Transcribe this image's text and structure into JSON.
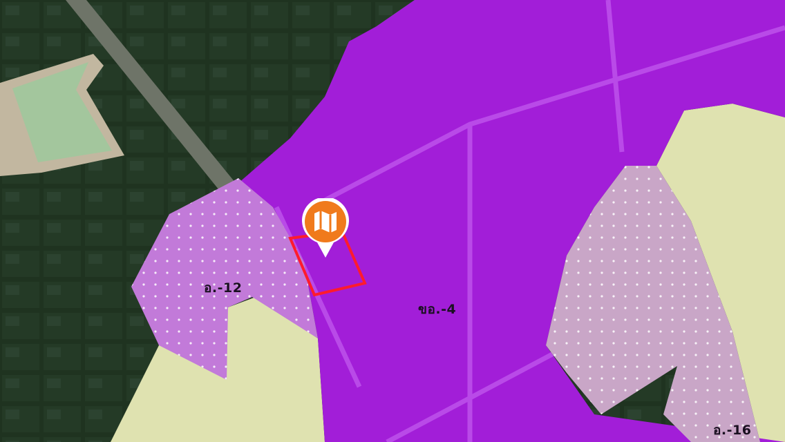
{
  "map": {
    "zones": [
      {
        "code": "ขอ.-4",
        "zone_type": "industrial",
        "color": "#a21ed8"
      },
      {
        "code": "อ.-12",
        "zone_type": "industrial-dotted",
        "color": "#c27ad9"
      },
      {
        "code": "อ.-16",
        "zone_type": "industrial-dotted",
        "color": "#c9a6c7"
      }
    ],
    "marker": {
      "icon": "map-folded-icon",
      "color": "#f07a1c"
    },
    "parcel": {
      "outline_color": "#ff1b2d"
    },
    "colors": {
      "rural_zone": "#dfe2b0",
      "conservation_zone": "#3fae6a",
      "satellite_dark": "#22341f"
    }
  }
}
